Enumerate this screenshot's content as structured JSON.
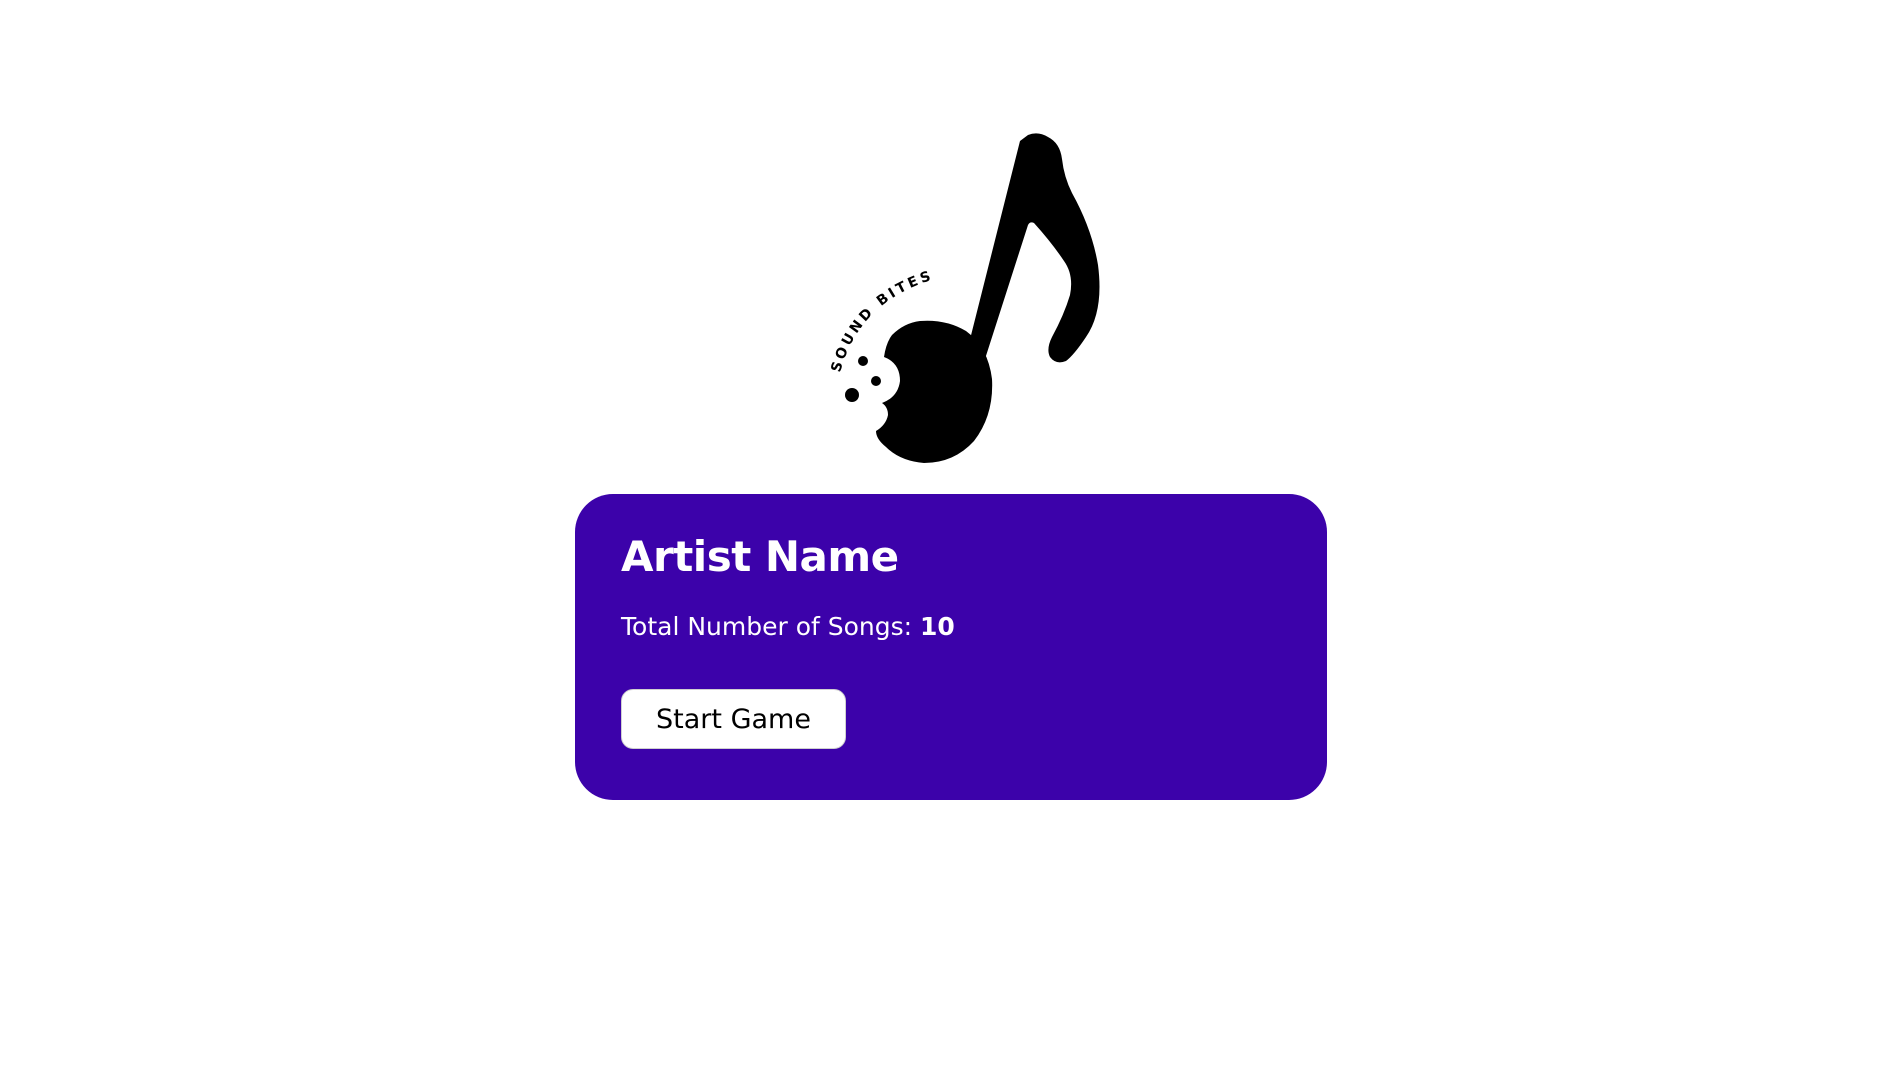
{
  "logo": {
    "text": "SOUND BITES",
    "icon": "music-note-icon"
  },
  "card": {
    "artist_name": "Artist Name",
    "songs_label": "Total Number of Songs:",
    "songs_count": "10",
    "start_button_label": "Start Game"
  },
  "colors": {
    "card_background": "#3c02aa",
    "card_text": "#ffffff",
    "button_background": "#ffffff",
    "button_text": "#000000"
  }
}
